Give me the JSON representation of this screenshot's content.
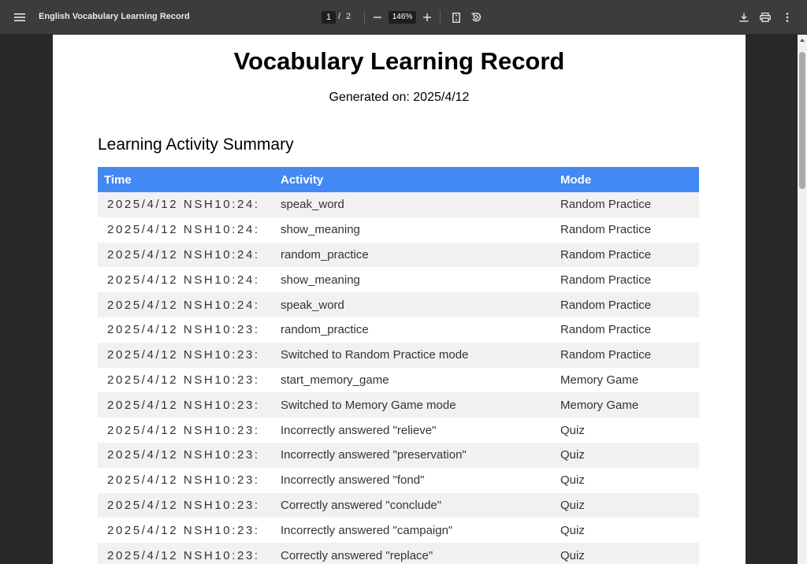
{
  "toolbar": {
    "title": "English Vocabulary Learning Record",
    "current_page": "1",
    "page_separator": "/",
    "total_pages": "2",
    "zoom": "146%"
  },
  "document": {
    "heading": "Vocabulary Learning Record",
    "generated": "Generated on: 2025/4/12",
    "section_title": "Learning Activity Summary",
    "table": {
      "headers": [
        "Time",
        "Activity",
        "Mode"
      ],
      "rows": [
        {
          "time": "2025/4/12 NSH10:24:",
          "activity": "speak_word",
          "mode": "Random Practice"
        },
        {
          "time": "2025/4/12 NSH10:24:",
          "activity": "show_meaning",
          "mode": "Random Practice"
        },
        {
          "time": "2025/4/12 NSH10:24:",
          "activity": "random_practice",
          "mode": "Random Practice"
        },
        {
          "time": "2025/4/12 NSH10:24:",
          "activity": "show_meaning",
          "mode": "Random Practice"
        },
        {
          "time": "2025/4/12 NSH10:24:",
          "activity": "speak_word",
          "mode": "Random Practice"
        },
        {
          "time": "2025/4/12 NSH10:23:",
          "activity": "random_practice",
          "mode": "Random Practice"
        },
        {
          "time": "2025/4/12 NSH10:23:",
          "activity": "Switched to Random Practice mode",
          "mode": "Random Practice"
        },
        {
          "time": "2025/4/12 NSH10:23:",
          "activity": "start_memory_game",
          "mode": "Memory Game"
        },
        {
          "time": "2025/4/12 NSH10:23:",
          "activity": "Switched to Memory Game mode",
          "mode": "Memory Game"
        },
        {
          "time": "2025/4/12 NSH10:23:",
          "activity": "Incorrectly answered \"relieve\"",
          "mode": "Quiz"
        },
        {
          "time": "2025/4/12 NSH10:23:",
          "activity": "Incorrectly answered \"preservation\"",
          "mode": "Quiz"
        },
        {
          "time": "2025/4/12 NSH10:23:",
          "activity": "Incorrectly answered \"fond\"",
          "mode": "Quiz"
        },
        {
          "time": "2025/4/12 NSH10:23:",
          "activity": "Correctly answered \"conclude\"",
          "mode": "Quiz"
        },
        {
          "time": "2025/4/12 NSH10:23:",
          "activity": "Incorrectly answered \"campaign\"",
          "mode": "Quiz"
        },
        {
          "time": "2025/4/12 NSH10:23:",
          "activity": "Correctly answered \"replace\"",
          "mode": "Quiz"
        }
      ]
    }
  },
  "colors": {
    "toolbar_bg": "#3c3c3c",
    "viewer_bg": "#282828",
    "table_header": "#4289f3",
    "row_stripe": "#f1f1f1"
  },
  "icons": [
    "menu-icon",
    "zoom-out-icon",
    "zoom-in-icon",
    "fit-page-icon",
    "rotate-icon",
    "download-icon",
    "print-icon",
    "more-vert-icon"
  ]
}
